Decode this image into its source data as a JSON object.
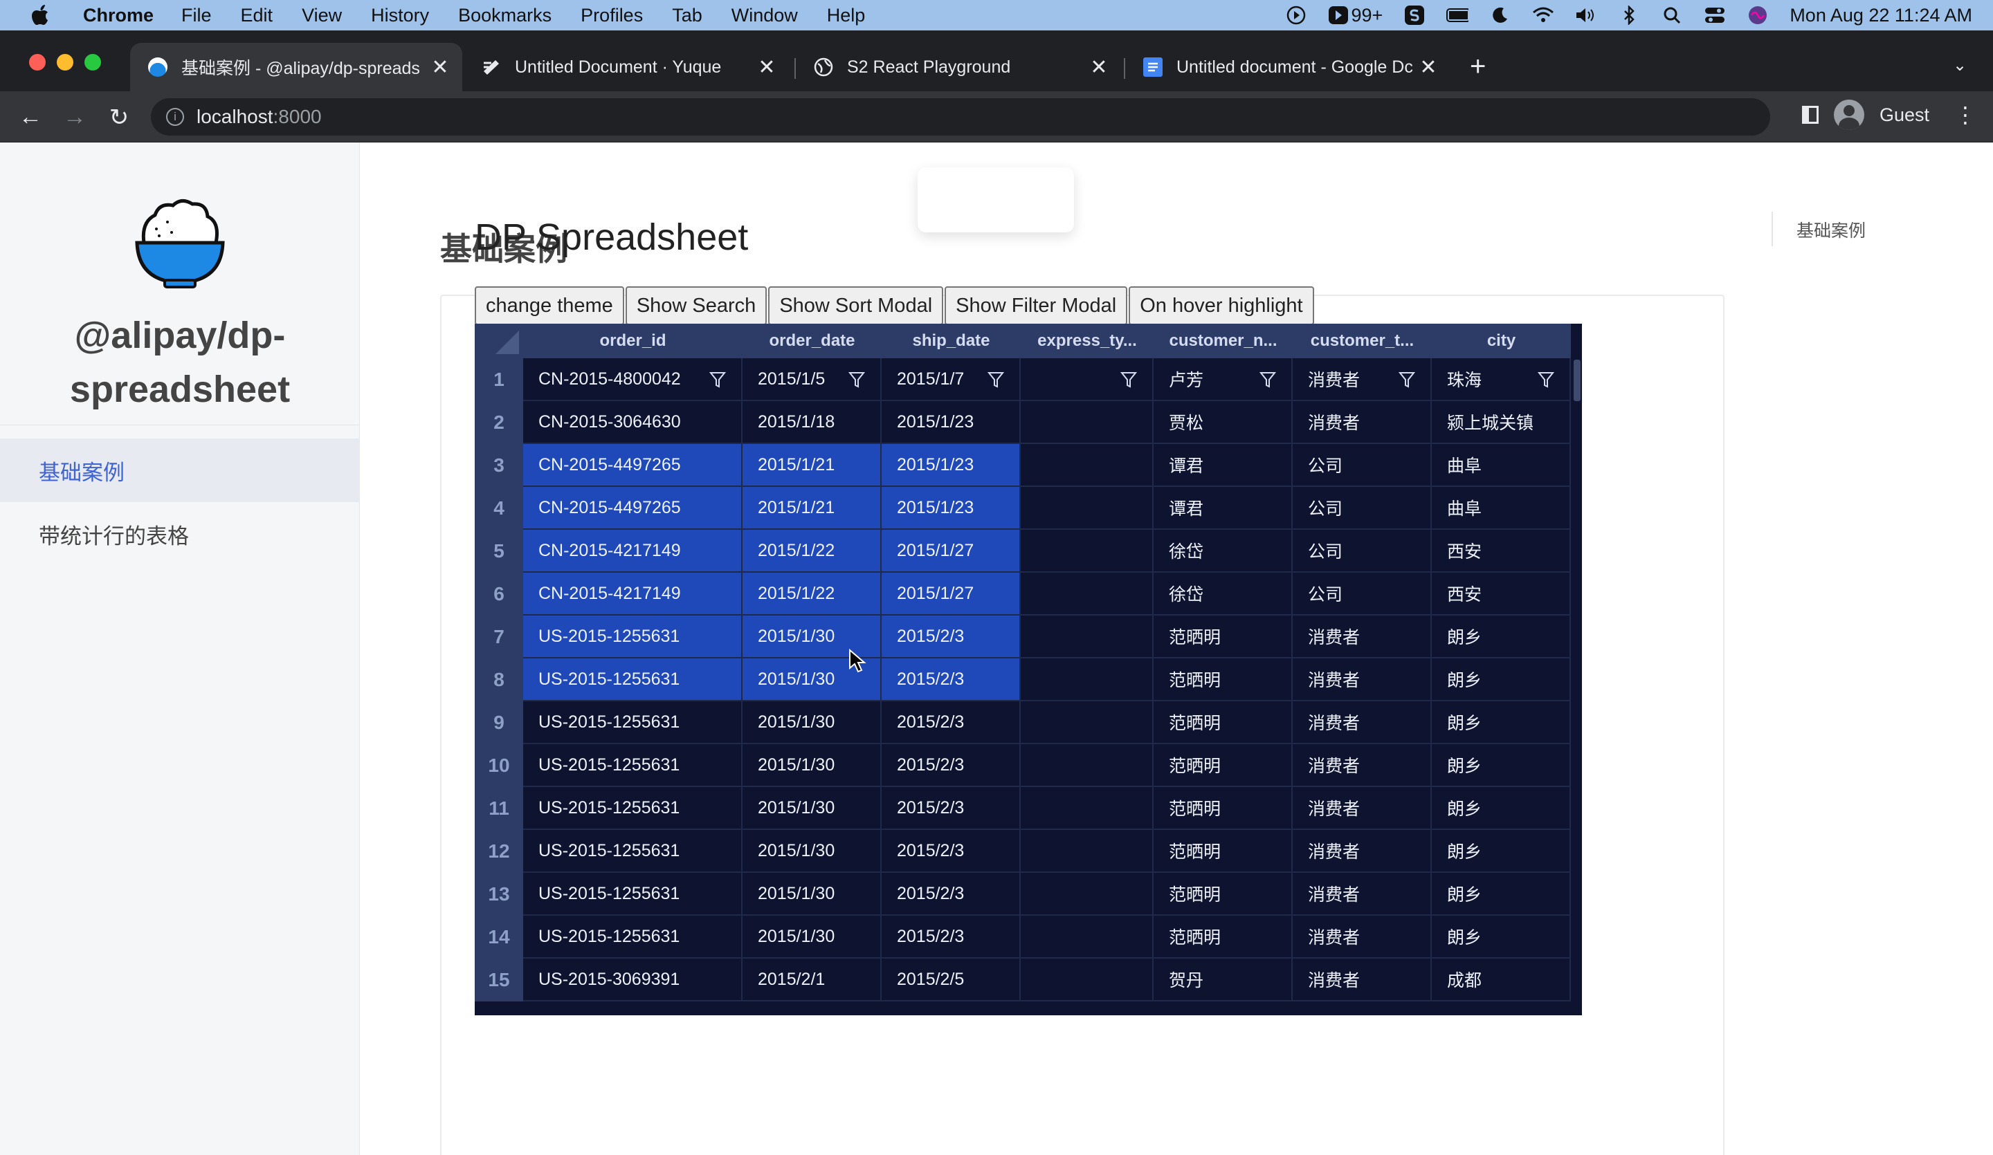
{
  "menubar": {
    "app": "Chrome",
    "items": [
      "File",
      "Edit",
      "View",
      "History",
      "Bookmarks",
      "Profiles",
      "Tab",
      "Window",
      "Help"
    ],
    "badge": "99+",
    "datetime": "Mon Aug 22  11:24 AM"
  },
  "tabs": [
    {
      "title": "基础案例 - @alipay/dp-spreads",
      "favicon": "dp-spreadsheet-favicon",
      "active": true
    },
    {
      "title": "Untitled Document · Yuque",
      "favicon": "yuque-favicon",
      "active": false
    },
    {
      "title": "S2 React Playground",
      "favicon": "globe-icon",
      "active": false
    },
    {
      "title": "Untitled document - Google Dc",
      "favicon": "google-docs-favicon",
      "active": false
    }
  ],
  "toolbar": {
    "url_host": "localhost",
    "url_port": ":8000",
    "profile": "Guest"
  },
  "sidebar": {
    "site_title": "@alipay/dp-spreadsheet",
    "items": [
      {
        "label": "基础案例",
        "active": true
      },
      {
        "label": "带统计行的表格",
        "active": false
      }
    ]
  },
  "main": {
    "page_title": "基础案例",
    "toc": [
      "基础案例"
    ],
    "demo_title": "DP Spreadsheet",
    "buttons": [
      "change theme",
      "Show Search",
      "Show Sort Modal",
      "Show Filter Modal",
      "On hover highlight"
    ]
  },
  "sheet": {
    "columns": [
      "order_id",
      "order_date",
      "ship_date",
      "express_ty...",
      "customer_n...",
      "customer_t...",
      "city"
    ],
    "filter_row": [
      "CN-2015-4800042",
      "2015/1/5",
      "2015/1/7",
      "",
      "卢芳",
      "消费者",
      "珠海"
    ],
    "rows": [
      [
        "CN-2015-3064630",
        "2015/1/18",
        "2015/1/23",
        "",
        "贾松",
        "消费者",
        "颍上城关镇"
      ],
      [
        "CN-2015-4497265",
        "2015/1/21",
        "2015/1/23",
        "",
        "谭君",
        "公司",
        "曲阜"
      ],
      [
        "CN-2015-4497265",
        "2015/1/21",
        "2015/1/23",
        "",
        "谭君",
        "公司",
        "曲阜"
      ],
      [
        "CN-2015-4217149",
        "2015/1/22",
        "2015/1/27",
        "",
        "徐岱",
        "公司",
        "西安"
      ],
      [
        "CN-2015-4217149",
        "2015/1/22",
        "2015/1/27",
        "",
        "徐岱",
        "公司",
        "西安"
      ],
      [
        "US-2015-1255631",
        "2015/1/30",
        "2015/2/3",
        "",
        "范晒明",
        "消费者",
        "朗乡"
      ],
      [
        "US-2015-1255631",
        "2015/1/30",
        "2015/2/3",
        "",
        "范晒明",
        "消费者",
        "朗乡"
      ],
      [
        "US-2015-1255631",
        "2015/1/30",
        "2015/2/3",
        "",
        "范晒明",
        "消费者",
        "朗乡"
      ],
      [
        "US-2015-1255631",
        "2015/1/30",
        "2015/2/3",
        "",
        "范晒明",
        "消费者",
        "朗乡"
      ],
      [
        "US-2015-1255631",
        "2015/1/30",
        "2015/2/3",
        "",
        "范晒明",
        "消费者",
        "朗乡"
      ],
      [
        "US-2015-1255631",
        "2015/1/30",
        "2015/2/3",
        "",
        "范晒明",
        "消费者",
        "朗乡"
      ],
      [
        "US-2015-1255631",
        "2015/1/30",
        "2015/2/3",
        "",
        "范晒明",
        "消费者",
        "朗乡"
      ],
      [
        "US-2015-1255631",
        "2015/1/30",
        "2015/2/3",
        "",
        "范晒明",
        "消费者",
        "朗乡"
      ],
      [
        "US-2015-3069391",
        "2015/2/1",
        "2015/2/5",
        "",
        "贺丹",
        "消费者",
        "成都"
      ]
    ],
    "selection": {
      "rows": [
        3,
        8
      ],
      "columns": [
        "order_id",
        "order_date",
        "ship_date"
      ]
    },
    "colors": {
      "background": "#0e1430",
      "header": "#2c3c66",
      "selected": "#1f49b8"
    }
  }
}
